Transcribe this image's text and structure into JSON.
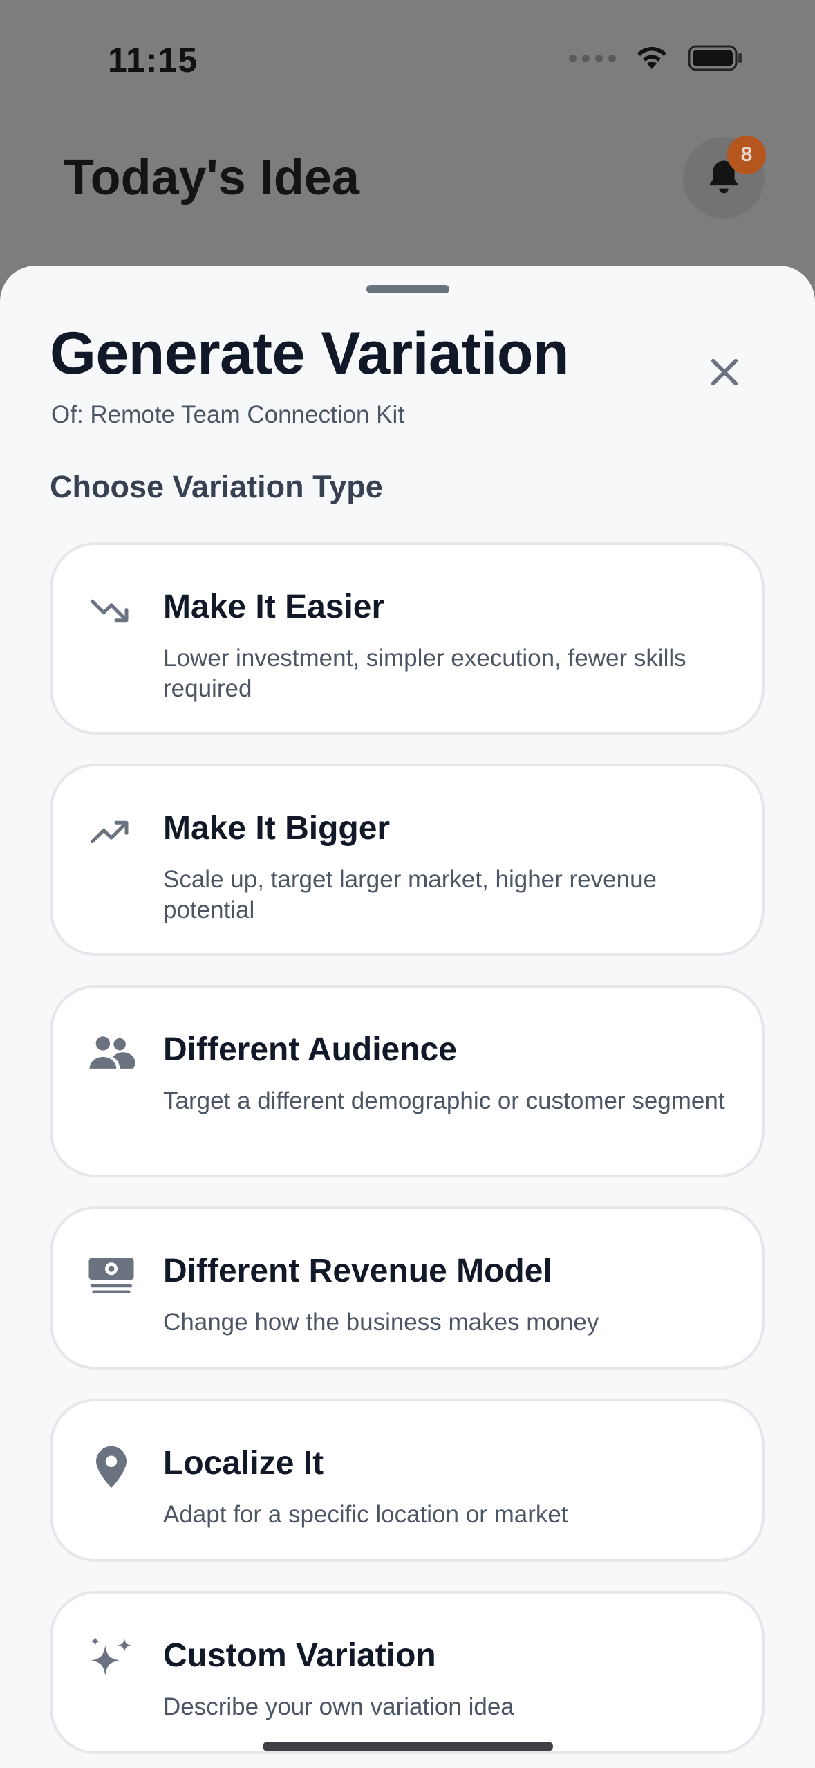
{
  "status_bar": {
    "time": "11:15"
  },
  "header": {
    "title": "Today's Idea",
    "notification_count": "8"
  },
  "sheet": {
    "title": "Generate Variation",
    "subtitle": "Of: Remote Team Connection Kit",
    "section_title": "Choose Variation Type"
  },
  "options": [
    {
      "icon": "trending-down-icon",
      "title": "Make It Easier",
      "description": "Lower investment, simpler execution, fewer skills required"
    },
    {
      "icon": "trending-up-icon",
      "title": "Make It Bigger",
      "description": "Scale up, target larger market, higher revenue potential"
    },
    {
      "icon": "users-icon",
      "title": "Different Audience",
      "description": "Target a different demographic or customer segment"
    },
    {
      "icon": "banknotes-icon",
      "title": "Different Revenue Model",
      "description": "Change how the business makes money"
    },
    {
      "icon": "map-pin-icon",
      "title": "Localize It",
      "description": "Adapt for a specific location or market"
    },
    {
      "icon": "sparkles-icon",
      "title": "Custom Variation",
      "description": "Describe your own variation idea"
    }
  ],
  "colors": {
    "accent_badge": "#b5561f",
    "title_text": "#111827",
    "muted_text": "#4b5563",
    "icon_color": "#6b7280"
  }
}
